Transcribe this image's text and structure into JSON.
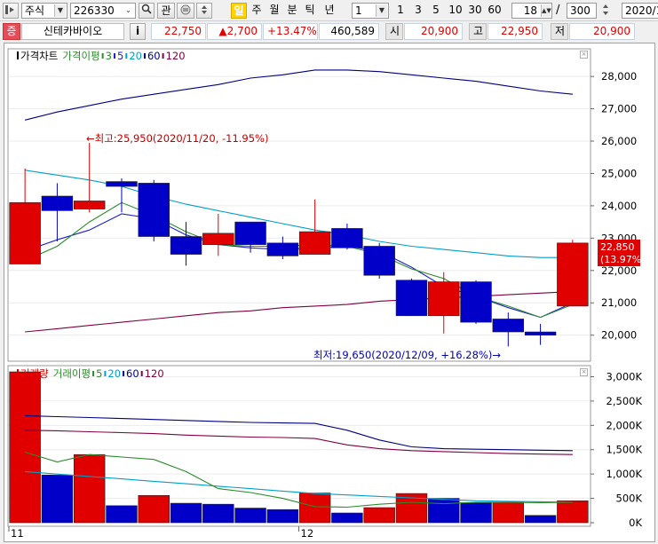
{
  "toolbar": {
    "market_type": "주식",
    "stock_code": "226330",
    "link_label": "관",
    "periods": [
      "일",
      "주",
      "월",
      "분",
      "틱",
      "년"
    ],
    "interval_value": "1",
    "interval_presets": [
      "1",
      "3",
      "5",
      "10",
      "30",
      "60"
    ],
    "visible_count": "18",
    "total_count": "300",
    "slash": "/",
    "date_value": "2020/1"
  },
  "info": {
    "market_badge": "증",
    "stock_name": "신테카바이오",
    "info_button": "i",
    "price": "22,750",
    "change": "▲2,700",
    "change_rate": "+13.47%",
    "volume": "460,589",
    "open_label": "시",
    "open": "20,900",
    "high_label": "고",
    "high": "22,950",
    "low_label": "저",
    "low": "20,900"
  },
  "price_panel": {
    "legend": [
      {
        "text": "가격차트",
        "color": "#000000"
      },
      {
        "text": "가격이평",
        "color": "#2a8c2a"
      },
      {
        "text": "3",
        "color": "#2a8c2a"
      },
      {
        "text": "5",
        "color": "#2020d0"
      },
      {
        "text": "20",
        "color": "#00a0c8"
      },
      {
        "text": "60",
        "color": "#000080"
      },
      {
        "text": "120",
        "color": "#800040"
      }
    ],
    "high_annotation": "←최고:25,950(2020/11/20, -11.95%)",
    "low_annotation": "최저:19,650(2020/12/09, +16.28%)→",
    "current_price_label": "22,850",
    "current_rate_label": "(13.97%)"
  },
  "volume_panel": {
    "legend": [
      {
        "text": "거래량",
        "color": "#e00000"
      },
      {
        "text": "거래이평",
        "color": "#2a8c2a"
      },
      {
        "text": "5",
        "color": "#2a8c2a"
      },
      {
        "text": "20",
        "color": "#00a0c8"
      },
      {
        "text": "60",
        "color": "#000080"
      },
      {
        "text": "120",
        "color": "#800040"
      }
    ]
  },
  "chart_data": [
    {
      "type": "candlestick",
      "title": "가격차트",
      "y_ticks": [
        20000,
        21000,
        22000,
        23000,
        24000,
        25000,
        26000,
        27000,
        28000
      ],
      "ylim": [
        19250,
        28800
      ],
      "candles": [
        {
          "o": 22200,
          "h": 25150,
          "l": 22200,
          "c": 24100,
          "up": true
        },
        {
          "o": 24300,
          "h": 24700,
          "l": 22900,
          "c": 23850,
          "up": false
        },
        {
          "o": 23900,
          "h": 25950,
          "l": 23800,
          "c": 24150,
          "up": true
        },
        {
          "o": 24750,
          "h": 24850,
          "l": 23800,
          "c": 24600,
          "up": false
        },
        {
          "o": 24700,
          "h": 24800,
          "l": 22900,
          "c": 23050,
          "up": false
        },
        {
          "o": 23050,
          "h": 23500,
          "l": 22150,
          "c": 22500,
          "up": false
        },
        {
          "o": 22800,
          "h": 23750,
          "l": 22450,
          "c": 23150,
          "up": true
        },
        {
          "o": 23500,
          "h": 23500,
          "l": 22550,
          "c": 22800,
          "up": false
        },
        {
          "o": 22850,
          "h": 23050,
          "l": 22350,
          "c": 22450,
          "up": false
        },
        {
          "o": 22500,
          "h": 24200,
          "l": 22500,
          "c": 23200,
          "up": true
        },
        {
          "o": 23300,
          "h": 23450,
          "l": 22650,
          "c": 22700,
          "up": false
        },
        {
          "o": 22750,
          "h": 22850,
          "l": 21750,
          "c": 21850,
          "up": false
        },
        {
          "o": 21700,
          "h": 21750,
          "l": 20600,
          "c": 20600,
          "up": false
        },
        {
          "o": 20600,
          "h": 21950,
          "l": 20050,
          "c": 21650,
          "up": true
        },
        {
          "o": 21650,
          "h": 21700,
          "l": 20350,
          "c": 20400,
          "up": false
        },
        {
          "o": 20500,
          "h": 20700,
          "l": 19650,
          "c": 20100,
          "up": false
        },
        {
          "o": 20100,
          "h": 20350,
          "l": 19700,
          "c": 20000,
          "up": false
        },
        {
          "o": 20900,
          "h": 22950,
          "l": 20900,
          "c": 22850,
          "up": true
        }
      ],
      "ma3": [
        22300,
        22750,
        23500,
        24100,
        23700,
        23200,
        22800,
        22750,
        22750,
        22800,
        22750,
        22500,
        22050,
        21750,
        21200,
        20900,
        20550,
        20950
      ],
      "ma5": [
        22600,
        22950,
        23250,
        23750,
        23600,
        23100,
        22800,
        22700,
        22650,
        22700,
        22750,
        22600,
        22100,
        21500,
        21200,
        20850,
        20550,
        21000
      ],
      "ma20": [
        25100,
        24950,
        24800,
        24600,
        24300,
        24050,
        23850,
        23650,
        23450,
        23250,
        23100,
        22900,
        22750,
        22650,
        22550,
        22450,
        22400,
        22400
      ],
      "ma60": [
        26650,
        26900,
        27100,
        27300,
        27450,
        27600,
        27750,
        27950,
        28050,
        28200,
        28200,
        28150,
        28050,
        27950,
        27850,
        27700,
        27550,
        27450
      ],
      "ma120": [
        20100,
        20200,
        20300,
        20400,
        20500,
        20600,
        20700,
        20750,
        20850,
        20900,
        20950,
        21050,
        21100,
        21150,
        21200,
        21250,
        21300,
        21350
      ]
    },
    {
      "type": "bar",
      "title": "거래량",
      "x_labels": [
        {
          "index": 0,
          "text": "11"
        },
        {
          "index": 9,
          "text": "12"
        }
      ],
      "y_ticks": [
        0,
        500,
        1000,
        1500,
        2000,
        2500,
        3000
      ],
      "y_tick_labels": [
        "0K",
        "500K",
        "1,000K",
        "1,500K",
        "2,000K",
        "2,500K",
        "3,000K"
      ],
      "ylim": [
        0,
        3100
      ],
      "unit": "K",
      "values": [
        3100,
        980,
        1400,
        350,
        560,
        400,
        380,
        300,
        270,
        610,
        200,
        310,
        600,
        500,
        410,
        420,
        150,
        450
      ],
      "up": [
        true,
        false,
        true,
        false,
        true,
        false,
        false,
        false,
        false,
        true,
        false,
        true,
        true,
        false,
        false,
        true,
        false,
        true
      ],
      "ma5": [
        1450,
        1250,
        1400,
        1350,
        1300,
        1050,
        700,
        620,
        500,
        330,
        320,
        380,
        420,
        390,
        420,
        420,
        410,
        420
      ],
      "ma20": [
        1050,
        1000,
        950,
        900,
        850,
        800,
        750,
        700,
        650,
        600,
        570,
        540,
        510,
        480,
        450,
        440,
        430,
        420
      ],
      "ma60": [
        2200,
        2180,
        2160,
        2140,
        2120,
        2100,
        2080,
        2060,
        2050,
        2040,
        1900,
        1700,
        1560,
        1520,
        1510,
        1500,
        1490,
        1480
      ],
      "ma120": [
        1900,
        1890,
        1870,
        1850,
        1830,
        1800,
        1780,
        1760,
        1750,
        1730,
        1600,
        1520,
        1480,
        1460,
        1440,
        1420,
        1410,
        1400
      ]
    }
  ]
}
